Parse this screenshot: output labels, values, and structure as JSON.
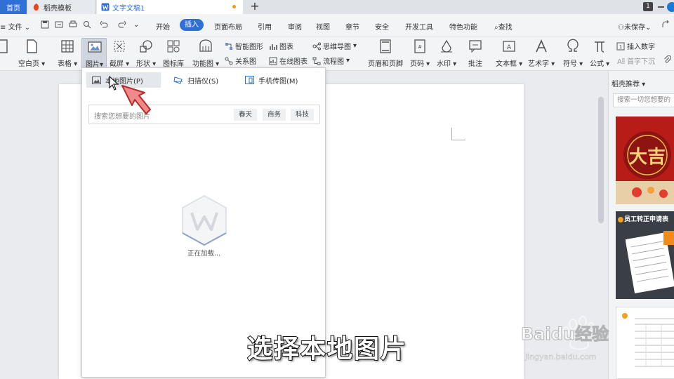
{
  "tabs": {
    "home": "首页",
    "daoke": "稻壳模板",
    "doc": "文字文稿1",
    "add": "+",
    "count": "1"
  },
  "menu": {
    "file": "文件",
    "items": [
      "开始",
      "插入",
      "页面布局",
      "引用",
      "审阅",
      "视图",
      "章节",
      "安全",
      "开发工具",
      "特色功能"
    ],
    "search": "查找",
    "unsaved": "未保存",
    "insert_active": "插入"
  },
  "ribbon": {
    "big": [
      {
        "label": "空白页",
        "icon": "blank-page-icon"
      },
      {
        "label": "表格",
        "icon": "table-icon"
      },
      {
        "label": "图片",
        "icon": "picture-icon"
      },
      {
        "label": "截屏",
        "icon": "screenshot-icon"
      },
      {
        "label": "形状",
        "icon": "shape-icon"
      },
      {
        "label": "图标库",
        "icon": "icon-library-icon"
      },
      {
        "label": "功能图",
        "icon": "function-chart-icon"
      },
      {
        "label": "页眉和页脚",
        "icon": "header-footer-icon"
      },
      {
        "label": "页码",
        "icon": "page-number-icon"
      },
      {
        "label": "水印",
        "icon": "watermark-icon"
      },
      {
        "label": "批注",
        "icon": "comment-icon"
      },
      {
        "label": "文本框",
        "icon": "textbox-icon"
      },
      {
        "label": "艺术字",
        "icon": "wordart-icon"
      },
      {
        "label": "符号",
        "icon": "symbol-icon"
      },
      {
        "label": "公式",
        "icon": "formula-icon"
      }
    ],
    "small": {
      "smart_shape": "智能图形",
      "chart": "图表",
      "mindmap": "思维导图",
      "relation": "关系图",
      "online_chart": "在线图表",
      "flowchart": "流程图",
      "insert_number": "插入数字",
      "drop_cap": "首字下沉"
    }
  },
  "popup": {
    "options": [
      "本地图片(P)",
      "扫描仪(S)",
      "手机传图(M)"
    ],
    "search_placeholder": "搜索您想要的图片",
    "tags": [
      "春天",
      "商务",
      "科技"
    ],
    "loading": "正在加载..."
  },
  "right_panel": {
    "title": "稻壳推荐",
    "search_placeholder": "搜索一切您想要的",
    "card1_text": "大吉",
    "card2_text": "员工转正申请表"
  },
  "caption": "选择本地图片",
  "watermark": {
    "brand": "Baidu经验",
    "url": "jingyan.baidu.com"
  },
  "colors": {
    "accent": "#2f6fd6",
    "pointer": "#f08a8a",
    "card_red": "#c0211d"
  }
}
